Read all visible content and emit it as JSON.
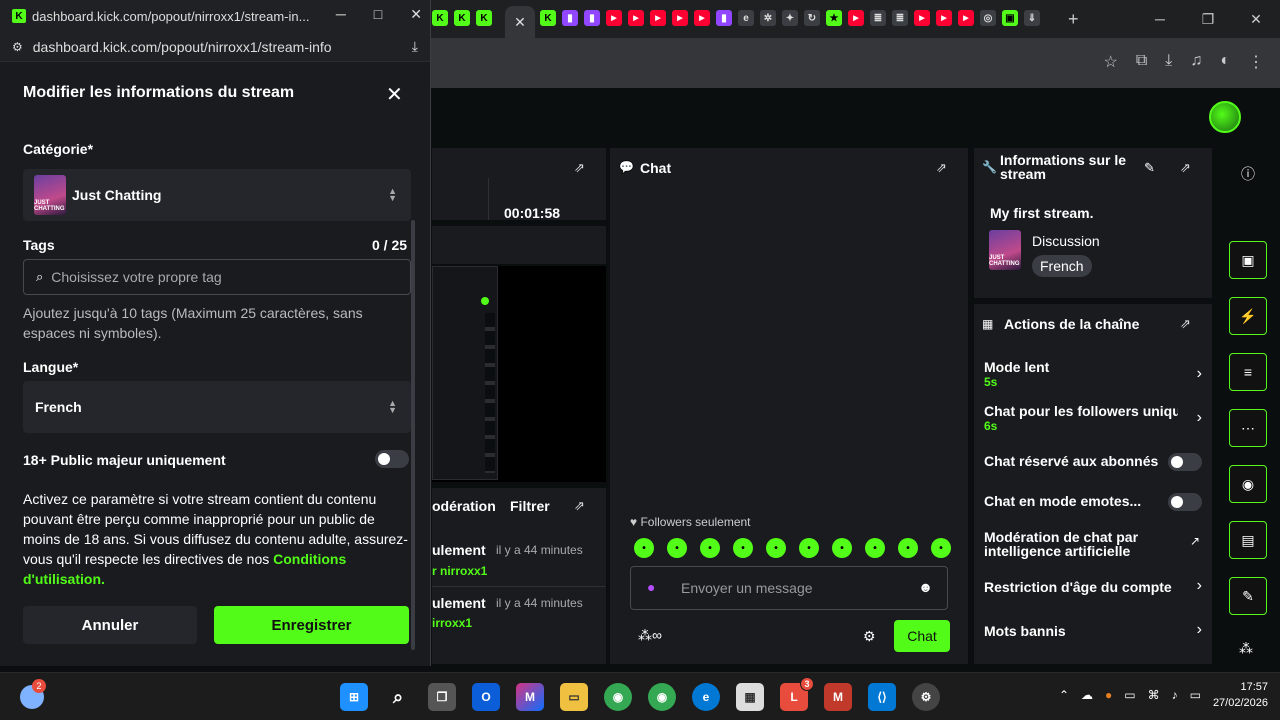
{
  "browser": {
    "popup_title": "dashboard.kick.com/popout/nirroxx1/stream-in...",
    "popup_url": "dashboard.kick.com/popout/nirroxx1/stream-info"
  },
  "dashboard": {
    "timer": "00:01:58",
    "moderation_tab": "odération",
    "filter_label": "Filtrer",
    "mod_events": [
      {
        "action": "ulement",
        "time": "il y a 44 minutes",
        "user": "r nirroxx1"
      },
      {
        "action": "ulement",
        "time": "il y a 44 minutes",
        "user": "irroxx1"
      }
    ],
    "chat": {
      "title": "Chat",
      "followers_only": "Followers seulement",
      "placeholder": "Envoyer un message",
      "send_label": "Chat"
    },
    "stream_info": {
      "title": "Informations sur le stream",
      "stream_title": "My first stream.",
      "category": "Discussion",
      "language": "French"
    },
    "channel_actions": {
      "title": "Actions de la chaîne",
      "items": [
        {
          "label": "Mode lent",
          "value": "5s",
          "control": "chevron"
        },
        {
          "label": "Chat pour les followers uniqu",
          "value": "6s",
          "control": "chevron"
        },
        {
          "label": "Chat réservé aux abonnés",
          "value": "",
          "control": "toggle"
        },
        {
          "label": "Chat en mode emotes...",
          "value": "",
          "control": "toggle"
        },
        {
          "label": "Modération de chat par intelligence artificielle",
          "value": "",
          "control": "external"
        },
        {
          "label": "Restriction d'âge du compte",
          "value": "",
          "control": "chevron"
        },
        {
          "label": "Mots bannis",
          "value": "",
          "control": "chevron"
        }
      ]
    }
  },
  "modal": {
    "title": "Modifier les informations du stream",
    "category_label": "Catégorie*",
    "category_value": "Just Chatting",
    "category_thumb_text": "JUST CHATTING",
    "tags_label": "Tags",
    "tags_count": "0 / 25",
    "tags_placeholder": "Choisissez votre propre tag",
    "tags_help": "Ajoutez jusqu'à 10 tags (Maximum 25 caractères, sans espaces ni symboles).",
    "language_label": "Langue*",
    "language_value": "French",
    "adult_label": "18+ Public majeur uniquement",
    "adult_enabled": false,
    "adult_warning": "Activez ce paramètre si votre stream contient du contenu pouvant être perçu comme inapproprié pour un public de moins de 18 ans. Si vous diffusez du contenu adulte, assurez-vous qu'il respecte les directives de nos",
    "terms_link": "Conditions d'utilisation.",
    "cancel_label": "Annuler",
    "save_label": "Enregistrer"
  },
  "taskbar": {
    "time": "17:57",
    "date": "27/02/2026",
    "weather_badge": "2",
    "badge_3": "3"
  },
  "colors": {
    "accent": "#53fc18",
    "panel": "#191b1f",
    "background": "#0b0e0f"
  }
}
